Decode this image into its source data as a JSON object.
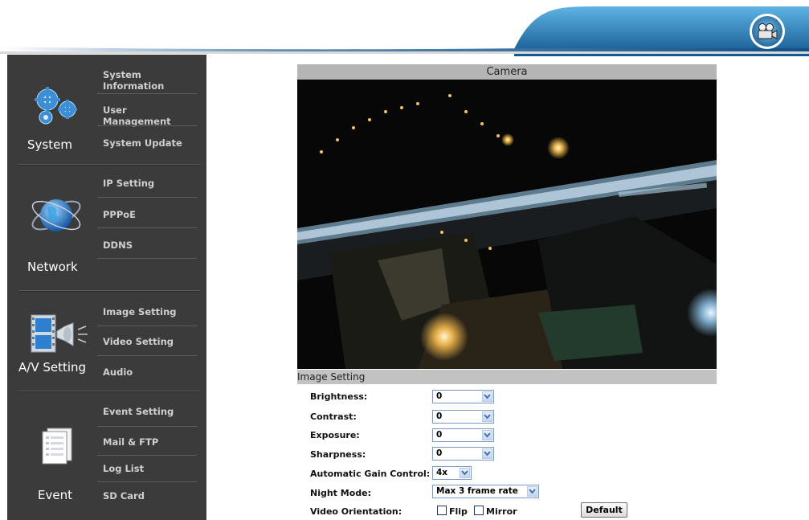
{
  "camera_panel": {
    "title": "Camera"
  },
  "sidebar": {
    "groups": [
      {
        "title": "System",
        "icon": "gears-icon",
        "items": [
          "System Information",
          "User Management",
          "System Update"
        ]
      },
      {
        "title": "Network",
        "icon": "globe-icon",
        "items": [
          "IP Setting",
          "PPPoE",
          "DDNS"
        ]
      },
      {
        "title": "A/V Setting",
        "icon": "av-icon",
        "items": [
          "Image Setting",
          "Video Setting",
          "Audio"
        ]
      },
      {
        "title": "Event",
        "icon": "document-icon",
        "items": [
          "Event Setting",
          "Mail & FTP",
          "Log List",
          "SD Card"
        ]
      }
    ]
  },
  "image_setting": {
    "title": "Image Setting",
    "brightness": {
      "label": "Brightness:",
      "value": "0"
    },
    "contrast": {
      "label": "Contrast:",
      "value": "0"
    },
    "exposure": {
      "label": "Exposure:",
      "value": "0"
    },
    "sharpness": {
      "label": "Sharpness:",
      "value": "0"
    },
    "agc": {
      "label": "Automatic Gain Control:",
      "value": "4x"
    },
    "night_mode": {
      "label": "Night Mode:",
      "value": "Max 3 frame rate"
    },
    "orientation": {
      "label": "Video Orientation:",
      "flip": "Flip",
      "mirror": "Mirror"
    },
    "default_button": "Default"
  },
  "colors": {
    "sidebar_bg": "#3b3b3b",
    "header_blue": "#1f6fa8",
    "bar_gray": "#b5b5b5"
  }
}
